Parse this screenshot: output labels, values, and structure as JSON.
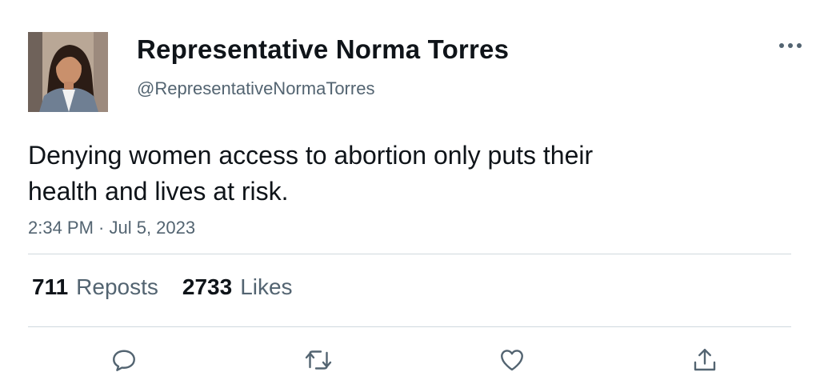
{
  "tweet": {
    "author": {
      "name": "Representative Norma Torres",
      "handle": "@RepresentativeNormaTorres",
      "avatar": "profile-photo"
    },
    "text": "Denying women access to abortion only puts their\nhealth and lives at risk.",
    "timestamp": "2:34 PM · Jul 5, 2023",
    "stats": {
      "reposts_count": "711",
      "reposts_label": "Reposts",
      "likes_count": "2733",
      "likes_label": "Likes"
    },
    "actions": [
      "reply-icon",
      "repost-icon",
      "like-icon",
      "share-icon"
    ]
  },
  "colors": {
    "text_primary": "#0f1419",
    "text_secondary": "#536471",
    "divider": "#cfd9de",
    "icon": "#536471"
  }
}
